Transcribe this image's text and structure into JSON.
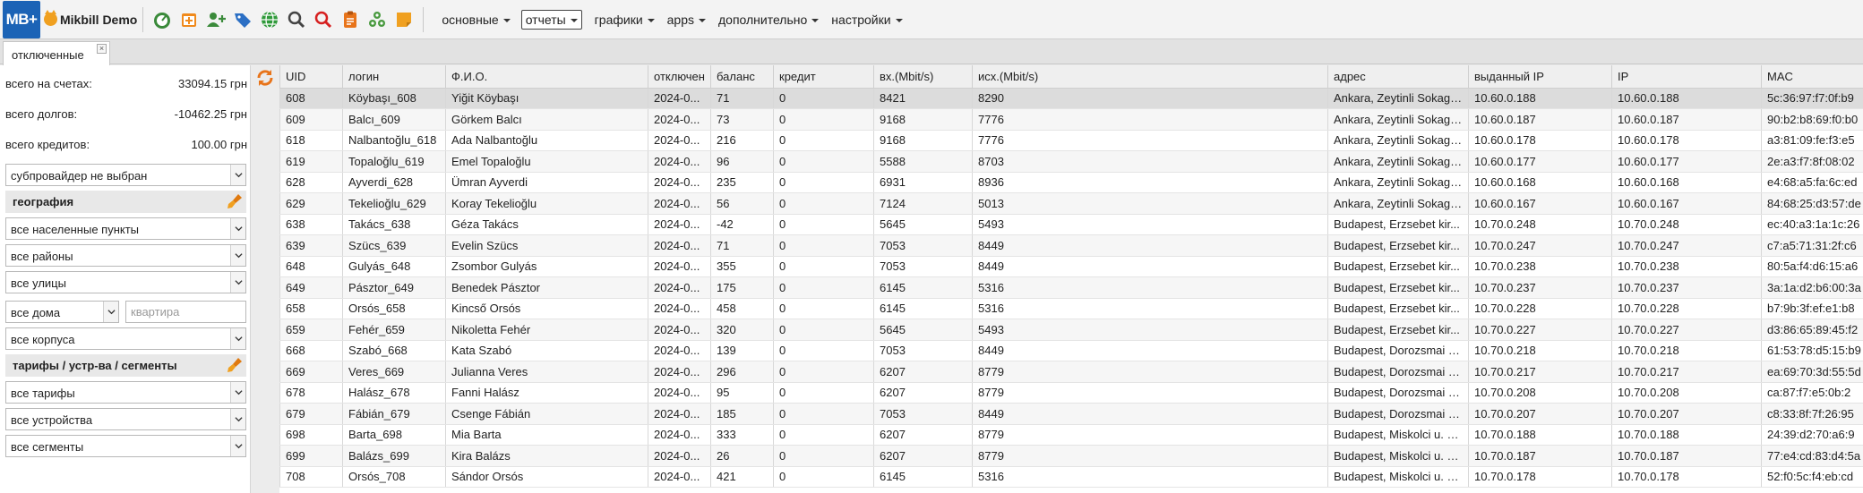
{
  "app": {
    "logo": "MB+",
    "title": "Mikbill Demo"
  },
  "toolbar": {
    "icons": [
      "dashboard-icon",
      "add-tab-icon",
      "add-user-icon",
      "tags-icon",
      "globe-icon",
      "search-icon",
      "search-red-icon",
      "clipboard-icon",
      "network-icon",
      "sticky-note-icon"
    ],
    "menus": [
      {
        "label": "основные",
        "active": false
      },
      {
        "label": "отчеты",
        "active": true
      },
      {
        "label": "графики",
        "active": false
      },
      {
        "label": "apps",
        "active": false
      },
      {
        "label": "дополнительно",
        "active": false
      },
      {
        "label": "настройки",
        "active": false
      }
    ]
  },
  "tab": {
    "label": "отключенные",
    "close": "×"
  },
  "summary": {
    "accounts_label": "всего на счетах:",
    "accounts_value": "33094.15 грн",
    "debts_label": "всего долгов:",
    "debts_value": "-10462.25 грн",
    "credits_label": "всего кредитов:",
    "credits_value": "100.00 грн"
  },
  "filters": {
    "subprovider": "субпровайдер не выбран",
    "geo_section": "география",
    "localities": "все населенные пункты",
    "districts": "все районы",
    "streets": "все улицы",
    "houses": "все дома",
    "apartment_placeholder": "квартира",
    "buildings": "все корпуса",
    "tariff_section": "тарифы / устр-ва / сегменты",
    "tariffs": "все тарифы",
    "devices": "все устройства",
    "segments": "все сегменты"
  },
  "table": {
    "columns": [
      "UID",
      "логин",
      "Ф.И.О.",
      "отключен",
      "баланс",
      "кредит",
      "вх.(Mbit/s)",
      "исх.(Mbit/s)",
      "адрес",
      "выданный IP",
      "IP",
      "MAC"
    ],
    "rows": [
      [
        "608",
        "Köybaşı_608",
        "Yiğit Köybaşı",
        "2024-0...",
        "71",
        "0",
        "8421",
        "8290",
        "Ankara, Zeytinli Sokagi ...",
        "10.60.0.188",
        "10.60.0.188",
        "5c:36:97:f7:0f:b9"
      ],
      [
        "609",
        "Balcı_609",
        "Görkem Balcı",
        "2024-0...",
        "73",
        "0",
        "9168",
        "7776",
        "Ankara, Zeytinli Sokagi ...",
        "10.60.0.187",
        "10.60.0.187",
        "90:b2:b8:69:f0:b0"
      ],
      [
        "618",
        "Nalbantoğlu_618",
        "Ada Nalbantoğlu",
        "2024-0...",
        "216",
        "0",
        "9168",
        "7776",
        "Ankara, Zeytinli Sokagi ...",
        "10.60.0.178",
        "10.60.0.178",
        "a3:81:09:fe:f3:e5"
      ],
      [
        "619",
        "Topaloğlu_619",
        "Emel Topaloğlu",
        "2024-0...",
        "96",
        "0",
        "5588",
        "8703",
        "Ankara, Zeytinli Sokagi ...",
        "10.60.0.177",
        "10.60.0.177",
        "2e:a3:f7:8f:08:02"
      ],
      [
        "628",
        "Ayverdi_628",
        "Ümran Ayverdi",
        "2024-0...",
        "235",
        "0",
        "6931",
        "8936",
        "Ankara, Zeytinli Sokagi ...",
        "10.60.0.168",
        "10.60.0.168",
        "e4:68:a5:fa:6c:ed"
      ],
      [
        "629",
        "Tekelioğlu_629",
        "Koray Tekelioğlu",
        "2024-0...",
        "56",
        "0",
        "7124",
        "5013",
        "Ankara, Zeytinli Sokagi ...",
        "10.60.0.167",
        "10.60.0.167",
        "84:68:25:d3:57:de"
      ],
      [
        "638",
        "Takács_638",
        "Géza Takács",
        "2024-0...",
        "-42",
        "0",
        "5645",
        "5493",
        "Budapest, Erzsebet kir...",
        "10.70.0.248",
        "10.70.0.248",
        "ec:40:a3:1a:1c:26"
      ],
      [
        "639",
        "Szücs_639",
        "Evelin Szücs",
        "2024-0...",
        "71",
        "0",
        "7053",
        "8449",
        "Budapest, Erzsebet kir...",
        "10.70.0.247",
        "10.70.0.247",
        "c7:a5:71:31:2f:c6"
      ],
      [
        "648",
        "Gulyás_648",
        "Zsombor Gulyás",
        "2024-0...",
        "355",
        "0",
        "7053",
        "8449",
        "Budapest, Erzsebet kir...",
        "10.70.0.238",
        "10.70.0.238",
        "80:5a:f4:d6:15:a6"
      ],
      [
        "649",
        "Pásztor_649",
        "Benedek Pásztor",
        "2024-0...",
        "175",
        "0",
        "6145",
        "5316",
        "Budapest, Erzsebet kir...",
        "10.70.0.237",
        "10.70.0.237",
        "3a:1a:d2:b6:00:3a"
      ],
      [
        "658",
        "Orsós_658",
        "Kincső Orsós",
        "2024-0...",
        "458",
        "0",
        "6145",
        "5316",
        "Budapest, Erzsebet kir...",
        "10.70.0.228",
        "10.70.0.228",
        "b7:9b:3f:ef:e1:b8"
      ],
      [
        "659",
        "Fehér_659",
        "Nikoletta Fehér",
        "2024-0...",
        "320",
        "0",
        "5645",
        "5493",
        "Budapest, Erzsebet kir...",
        "10.70.0.227",
        "10.70.0.227",
        "d3:86:65:89:45:f2"
      ],
      [
        "668",
        "Szabó_668",
        "Kata Szabó",
        "2024-0...",
        "139",
        "0",
        "7053",
        "8449",
        "Budapest, Dorozsmai u...",
        "10.70.0.218",
        "10.70.0.218",
        "61:53:78:d5:15:b9"
      ],
      [
        "669",
        "Veres_669",
        "Julianna Veres",
        "2024-0...",
        "296",
        "0",
        "6207",
        "8779",
        "Budapest, Dorozsmai u...",
        "10.70.0.217",
        "10.70.0.217",
        "ea:69:70:3d:55:5d"
      ],
      [
        "678",
        "Halász_678",
        "Fanni Halász",
        "2024-0...",
        "95",
        "0",
        "6207",
        "8779",
        "Budapest, Dorozsmai u...",
        "10.70.0.208",
        "10.70.0.208",
        "ca:87:f7:e5:0b:2"
      ],
      [
        "679",
        "Fábián_679",
        "Csenge Fábián",
        "2024-0...",
        "185",
        "0",
        "7053",
        "8449",
        "Budapest, Dorozsmai u...",
        "10.70.0.207",
        "10.70.0.207",
        "c8:33:8f:7f:26:95"
      ],
      [
        "698",
        "Barta_698",
        "Mia Barta",
        "2024-0...",
        "333",
        "0",
        "6207",
        "8779",
        "Budapest, Miskolci u. 1...",
        "10.70.0.188",
        "10.70.0.188",
        "24:39:d2:70:a6:9"
      ],
      [
        "699",
        "Balázs_699",
        "Kira Balázs",
        "2024-0...",
        "26",
        "0",
        "6207",
        "8779",
        "Budapest, Miskolci u. 1...",
        "10.70.0.187",
        "10.70.0.187",
        "77:e4:cd:83:d4:5a"
      ],
      [
        "708",
        "Orsós_708",
        "Sándor Orsós",
        "2024-0...",
        "421",
        "0",
        "6145",
        "5316",
        "Budapest, Miskolci u. 1...",
        "10.70.0.178",
        "10.70.0.178",
        "52:f0:5c:f4:eb:cd"
      ]
    ]
  }
}
